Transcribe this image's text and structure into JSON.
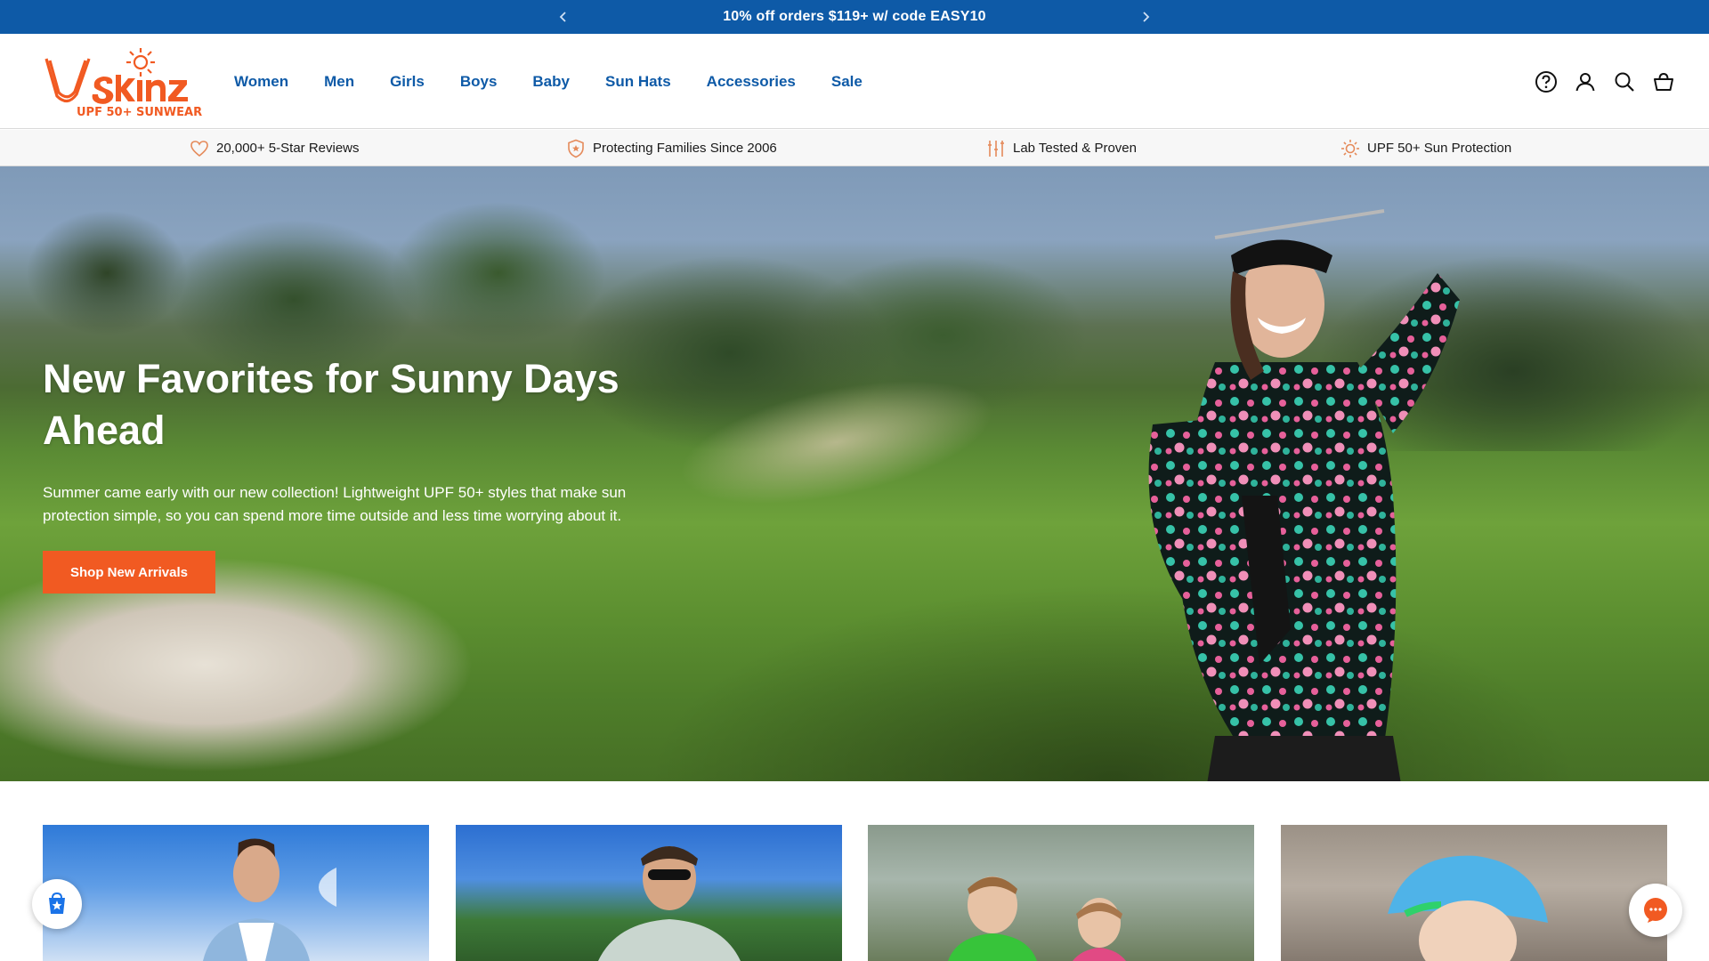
{
  "announcement": {
    "message": "10% off orders $119+ w/ code EASY10",
    "prev_icon": "chevron-left-icon",
    "next_icon": "chevron-right-icon"
  },
  "header": {
    "logo_text": "UV Skinz",
    "logo_tagline": "UPF 50+ SUNWEAR",
    "nav": [
      {
        "label": "Women"
      },
      {
        "label": "Men"
      },
      {
        "label": "Girls"
      },
      {
        "label": "Boys"
      },
      {
        "label": "Baby"
      },
      {
        "label": "Sun Hats"
      },
      {
        "label": "Accessories"
      },
      {
        "label": "Sale"
      }
    ],
    "icons": [
      "help-icon",
      "account-icon",
      "search-icon",
      "cart-icon"
    ]
  },
  "trust_bar": [
    {
      "label": "20,000+ 5-Star Reviews",
      "icon": "heart-icon"
    },
    {
      "label": "Protecting Families Since 2006",
      "icon": "shield-icon"
    },
    {
      "label": "Lab Tested & Proven",
      "icon": "lab-icon"
    },
    {
      "label": "UPF 50+ Sun Protection",
      "icon": "sun-icon"
    }
  ],
  "hero": {
    "title": "New Favorites for Sunny Days Ahead",
    "description": "Summer came early with our new collection! Lightweight UPF 50+ styles that make sun protection simple, so you can spend more time outside and less time worrying about it.",
    "cta_label": "Shop New Arrivals"
  },
  "colors": {
    "brand_blue": "#0e5aa7",
    "brand_orange": "#f15a22"
  }
}
